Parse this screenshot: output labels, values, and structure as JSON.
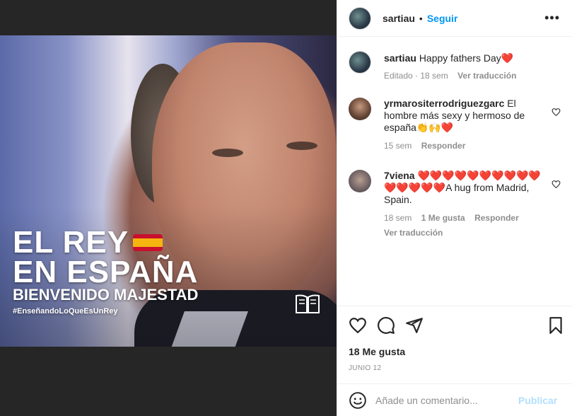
{
  "post_image": {
    "line1": "EL REY",
    "line2": "EN ESPAÑA",
    "line3": "BIENVENIDO MAJESTAD",
    "hashtag": "#EnseñandoLoQueEsUnRey"
  },
  "header": {
    "username": "sartiau",
    "separator": "•",
    "follow_label": "Seguir",
    "more_label": "•••"
  },
  "caption": {
    "username": "sartiau",
    "text": "Happy fathers Day❤️",
    "edited": "Editado · 18 sem",
    "translate": "Ver traducción"
  },
  "comments": [
    {
      "username": "yrmarositerrodriguezgarc",
      "text": "El hombre más sexy y hermoso de españa👏🙌❤️",
      "time": "15 sem",
      "reply": "Responder"
    },
    {
      "username": "7viena",
      "text": "❤️❤️❤️❤️❤️❤️❤️❤️❤️❤️❤️❤️❤️❤️❤️A hug from Madrid, Spain.",
      "time": "18 sem",
      "likes": "1 Me gusta",
      "reply": "Responder",
      "translate": "Ver traducción"
    }
  ],
  "actions": {
    "likes": "18 Me gusta",
    "date": "JUNIO 12"
  },
  "comment_box": {
    "placeholder": "Añade un comentario...",
    "publish_label": "Publicar"
  },
  "colors": {
    "accent": "#0095f6",
    "publish_disabled": "#b2dffc",
    "meta_grey": "#8e8e8e"
  }
}
